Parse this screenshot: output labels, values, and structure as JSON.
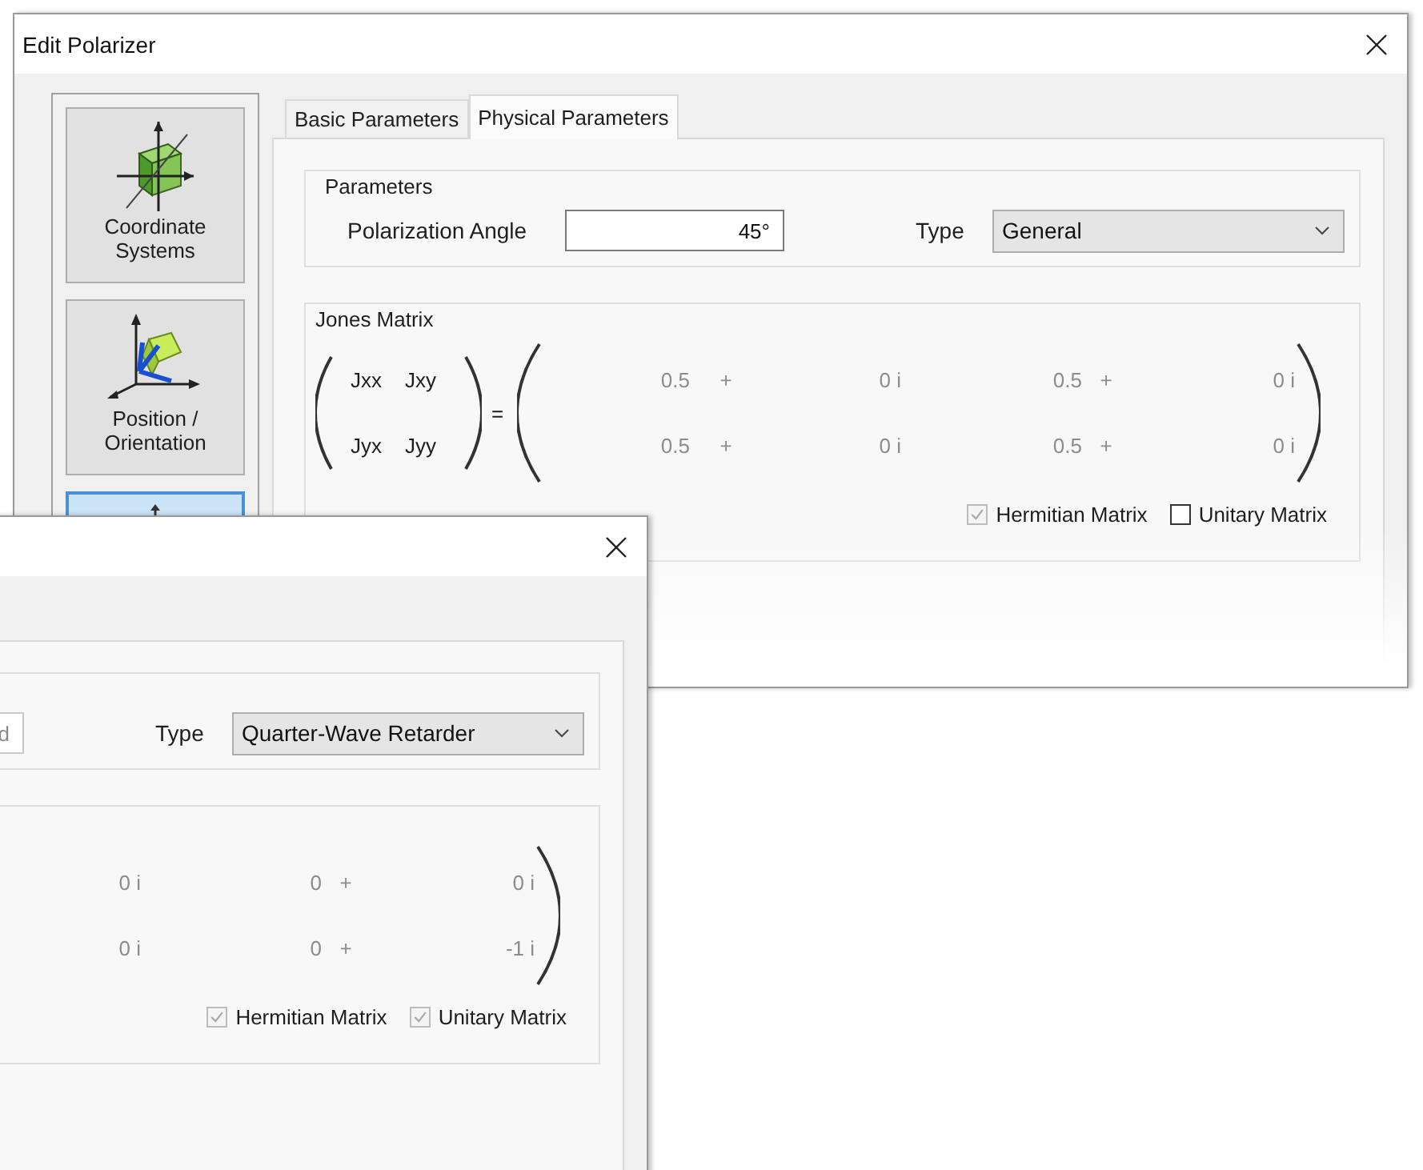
{
  "windows": [
    {
      "title": "Edit Polarizer",
      "sidebar": {
        "items": [
          {
            "label": "Coordinate Systems",
            "selected": false
          },
          {
            "label": "Position / Orientation",
            "selected": false
          },
          {
            "selected": true
          }
        ]
      },
      "tabs": [
        {
          "label": "Basic Parameters",
          "selected": false
        },
        {
          "label": "Physical Parameters",
          "selected": true
        }
      ],
      "parameters": {
        "legend": "Parameters",
        "angle_label": "Polarization Angle",
        "angle_value": "45°",
        "type_label": "Type",
        "type_value": "General"
      },
      "jones": {
        "legend": "Jones Matrix",
        "symbols": [
          "Jxx",
          "Jxy",
          "Jyx",
          "Jyy"
        ],
        "equals": "=",
        "rows": [
          [
            "0.5",
            "+",
            "0 i",
            "0.5",
            "+",
            "0 i"
          ],
          [
            "0.5",
            "+",
            "0 i",
            "0.5",
            "+",
            "0 i"
          ]
        ]
      },
      "checkboxes": [
        {
          "label": "Hermitian Matrix",
          "checked": true,
          "disabled": true
        },
        {
          "label": "Unitary Matrix",
          "checked": false,
          "disabled": false
        }
      ]
    },
    {
      "parameters": {
        "angle_value": "d",
        "type_label": "Type",
        "type_value": "Quarter-Wave Retarder"
      },
      "jones": {
        "rows": [
          [
            "0 i",
            "0",
            "+",
            "0 i"
          ],
          [
            "0 i",
            "0",
            "+",
            "-1 i"
          ]
        ]
      },
      "checkboxes": [
        {
          "label": "Hermitian Matrix",
          "checked": true,
          "disabled": true
        },
        {
          "label": "Unitary Matrix",
          "checked": true,
          "disabled": true
        }
      ]
    }
  ]
}
